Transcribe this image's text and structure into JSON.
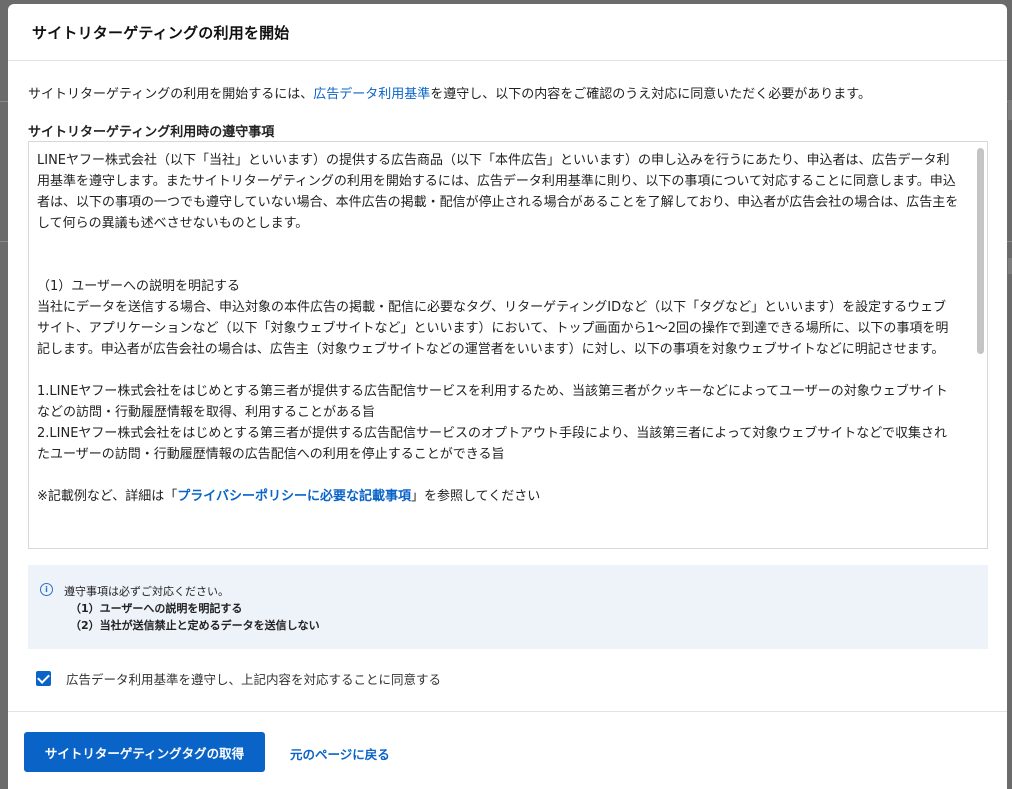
{
  "modal": {
    "title": "サイトリターゲティングの利用を開始"
  },
  "intro": {
    "before": "サイトリターゲティングの利用を開始するには、",
    "link": "広告データ利用基準",
    "after": "を遵守し、以下の内容をご確認のうえ対応に同意いただく必要があります。"
  },
  "terms": {
    "title": "サイトリターゲティング利用時の遵守事項",
    "paragraph1": "LINEヤフー株式会社（以下「当社」といいます）の提供する広告商品（以下「本件広告」といいます）の申し込みを行うにあたり、申込者は、広告データ利用基準を遵守します。またサイトリターゲティングの利用を開始するには、広告データ利用基準に則り、以下の事項について対応することに同意します。申込者は、以下の事項の一つでも遵守していない場合、本件広告の掲載・配信が停止される場合があることを了解しており、申込者が広告会社の場合は、広告主をして何らの異議も述べさせないものとします。",
    "heading1": "（1）ユーザーへの説明を明記する",
    "paragraph2": "当社にデータを送信する場合、申込対象の本件広告の掲載・配信に必要なタグ、リターゲティングIDなど（以下「タグなど」といいます）を設定するウェブサイト、アプリケーションなど（以下「対象ウェブサイトなど」といいます）において、トップ画面から1〜2回の操作で到達できる場所に、以下の事項を明記します。申込者が広告会社の場合は、広告主（対象ウェブサイトなどの運営者をいいます）に対し、以下の事項を対象ウェブサイトなどに明記させます。",
    "item1": "1.LINEヤフー株式会社をはじめとする第三者が提供する広告配信サービスを利用するため、当該第三者がクッキーなどによってユーザーの対象ウェブサイトなどの訪問・行動履歴情報を取得、利用することがある旨",
    "item2": "2.LINEヤフー株式会社をはじめとする第三者が提供する広告配信サービスのオプトアウト手段により、当該第三者によって対象ウェブサイトなどで収集されたユーザーの訪問・行動履歴情報の広告配信への利用を停止することができる旨",
    "note_before": "※記載例など、詳細は「",
    "note_link": "プライバシーポリシーに必要な記載事項",
    "note_after": "」を参照してください"
  },
  "notice": {
    "icon": "info-icon",
    "line1": "遵守事項は必ずご対応ください。",
    "line2": "（1）ユーザーへの説明を明記する",
    "line3": "（2）当社が送信禁止と定めるデータを送信しない"
  },
  "agreement": {
    "checked": true,
    "label": "広告データ利用基準を遵守し、上記内容を対応することに同意する"
  },
  "footer": {
    "primary_button": "サイトリターゲティングタグの取得",
    "back_link": "元のページに戻る"
  },
  "colors": {
    "accent": "#0a64c8",
    "notice_bg": "#eef3f9",
    "overlay": "#6f6f6f"
  }
}
